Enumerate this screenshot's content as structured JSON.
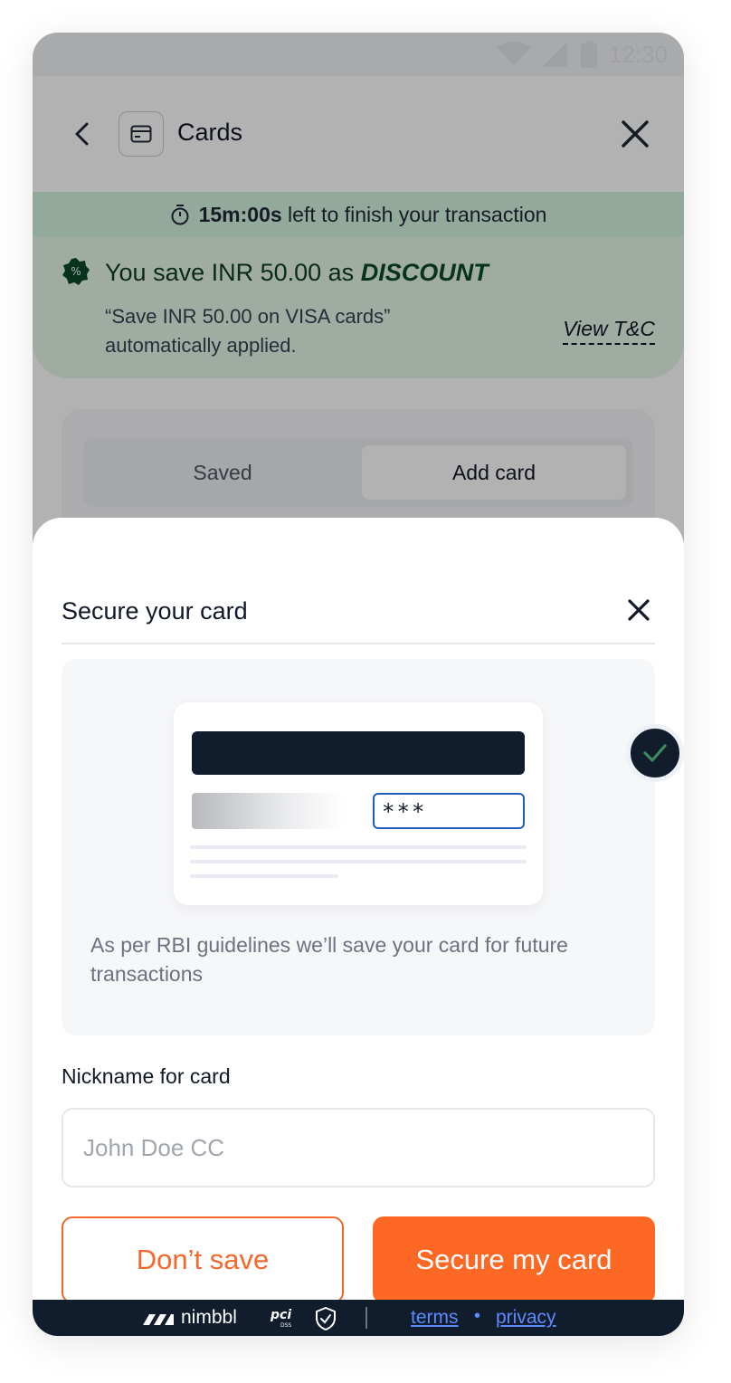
{
  "status_bar": {
    "time": "12:30",
    "wifi_icon": "wifi-icon",
    "signal_icon": "signal-icon",
    "battery_icon": "battery-icon"
  },
  "header": {
    "title": "Cards",
    "back_icon": "chevron-left-icon",
    "card_icon": "credit-card-icon",
    "close_icon": "close-icon"
  },
  "timer": {
    "time": "15m:00s",
    "text": "left to finish your transaction",
    "icon": "stopwatch-icon"
  },
  "discount": {
    "title_prefix": "You save INR 50.00 as",
    "title_emphasis": "DISCOUNT",
    "subtitle": "“Save INR 50.00 on VISA cards” automatically applied.",
    "view_tc": "View T&C",
    "icon": "discount-badge-icon"
  },
  "tabs": {
    "saved": "Saved",
    "add_card": "Add card",
    "active": "Add card"
  },
  "sheet": {
    "title": "Secure your card",
    "close_icon": "close-icon",
    "illustration": {
      "cvv_mask": "***",
      "check_icon": "checkmark-icon"
    },
    "info_text": "As per RBI guidelines we’ll save your card for future transactions",
    "nickname_label": "Nickname for card",
    "nickname_placeholder": "John Doe CC",
    "nickname_value": "",
    "dont_save_label": "Don’t save",
    "secure_label": "Secure my card"
  },
  "footer": {
    "brand": "nimbbl",
    "terms": "terms",
    "separator": "•",
    "privacy": "privacy",
    "pci_icon": "pci-dss-icon",
    "shield_icon": "shield-check-icon"
  },
  "colors": {
    "accent": "#fd6825",
    "footer_bg": "#111c2d",
    "discount_bg": "#e5f7e9",
    "timer_bg": "#d3f2de",
    "link": "#5b8cff"
  }
}
